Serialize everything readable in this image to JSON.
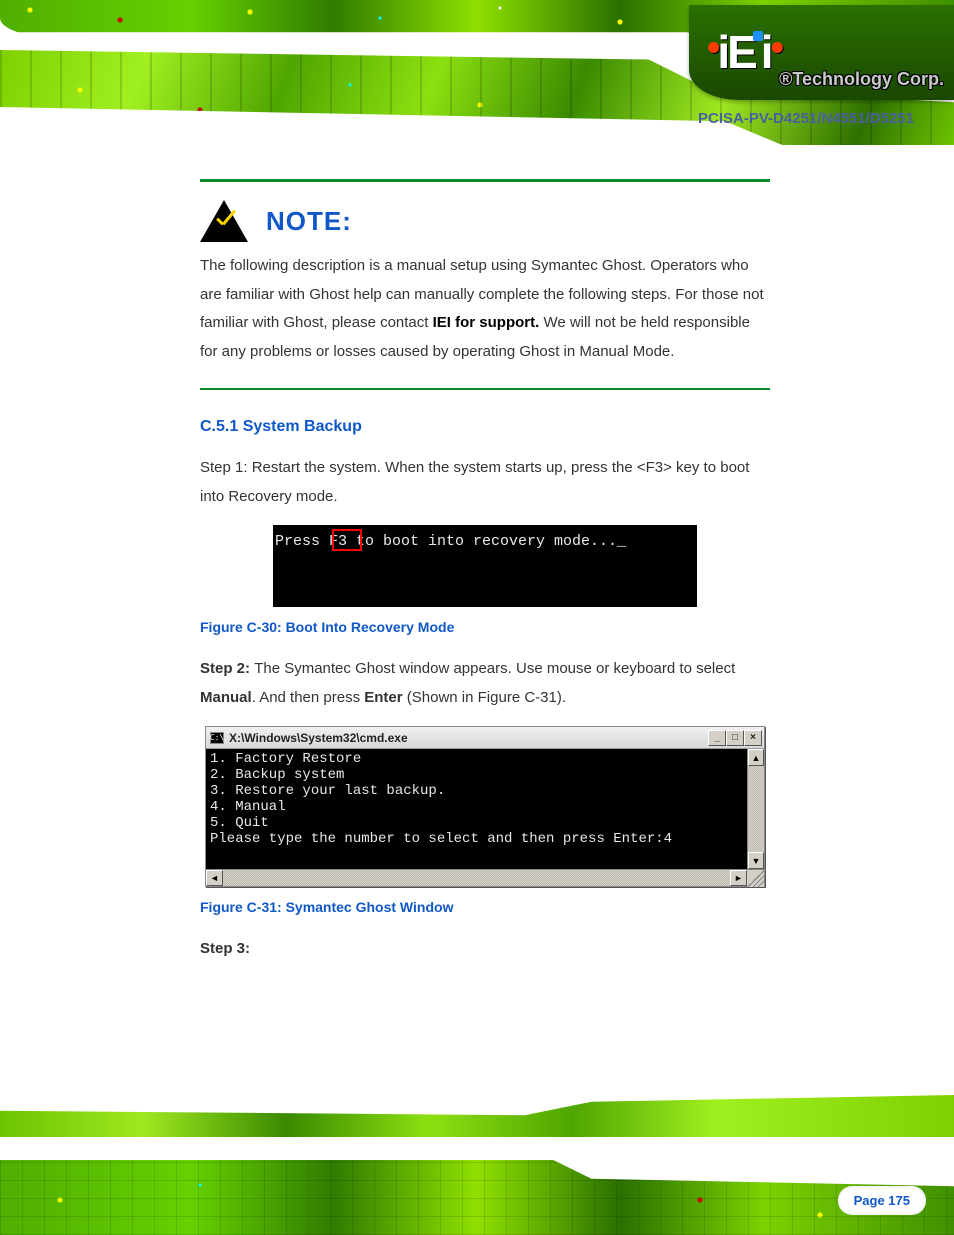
{
  "brand": {
    "logo_text": "iEi",
    "company": "®Technology Corp.",
    "product": "PCISA-PV-D4251/N4551/D5251"
  },
  "note": {
    "label": "NOTE:",
    "body_prefix": "The following description is a manual setup using Symantec Ghost. Operators who are familiar with Ghost help can manually complete the following steps. For those not familiar with Ghost, please contact ",
    "body_bold": "IEI for support.",
    "body_suffix": " We will not be held responsible for any problems or losses caused by operating Ghost in Manual Mode."
  },
  "section_heading": "C.5.1 System Backup",
  "steps": {
    "s1_full": "Step 1: Restart the system. When the system starts up, press the <F3> key to boot into Recovery mode.",
    "s2_prefix": "Step 2: ",
    "s2_body": "The Symantec Ghost window appears. Use mouse or keyboard to select ",
    "s2_bold1": "Manual",
    "s2_mid": ". And then press ",
    "s2_bold2": "Enter",
    "s2_tail": " (Shown in Figure C-31).",
    "s3_prefix": "Step 3:",
    "fig1_caption": "Figure C-30: Boot Into Recovery Mode",
    "fig2_caption": "Figure C-31: Symantec Ghost Window"
  },
  "fig1_terminal": "Press F3 to boot into recovery mode..._",
  "fig2": {
    "title": "X:\\Windows\\System32\\cmd.exe",
    "lines": "1. Factory Restore\n2. Backup system\n3. Restore your last backup.\n4. Manual\n5. Quit\nPlease type the number to select and then press Enter:4"
  },
  "page_number": "Page 175"
}
